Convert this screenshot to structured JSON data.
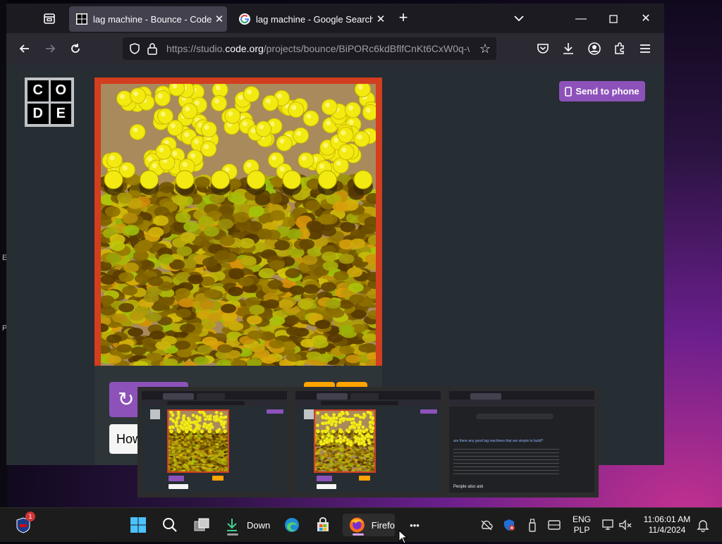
{
  "desktop": {
    "edge_letters": [
      "E",
      "P"
    ]
  },
  "browser": {
    "tabs": [
      {
        "title": "lag machine - Bounce - Code.or",
        "favicon": "codeorg-icon",
        "active": true
      },
      {
        "title": "lag machine - Google Search",
        "favicon": "google-icon",
        "active": false
      }
    ],
    "window_controls": [
      "minimize",
      "maximize",
      "close"
    ],
    "url": {
      "prefix": "https://studio.",
      "host": "code.org",
      "path": "/projects/bounce/BiPORc6kdBflfCnKt6CxW0q-vi"
    }
  },
  "page": {
    "logo_letters": [
      "C",
      "O",
      "D",
      "E"
    ],
    "send_to_phone": "Send to phone",
    "how_it_works_visible": "How",
    "colors": {
      "accent": "#8c52ba",
      "frame": "#d23e1e",
      "ball": "#f2ea10",
      "orange": "#ffa400"
    }
  },
  "previews": [
    {
      "kind": "bounce-dense",
      "reset": "Reset",
      "how": "How It Works",
      "send": "Send to phone"
    },
    {
      "kind": "bounce-light",
      "reset": "Reset",
      "how": "How It Works",
      "send": "Send to phone"
    },
    {
      "kind": "google-search",
      "query": "lag machine",
      "result_title": "are there any good lag machines that are simple to build?",
      "footer": "People also ask"
    }
  ],
  "taskbar": {
    "notification_badge": "1",
    "downloads_label": "Down",
    "firefox_label": "Firefo",
    "more": "•••",
    "lang_1": "ENG",
    "lang_2": "PLP",
    "time": "11:06:01 AM",
    "date": "11/4/2024"
  }
}
